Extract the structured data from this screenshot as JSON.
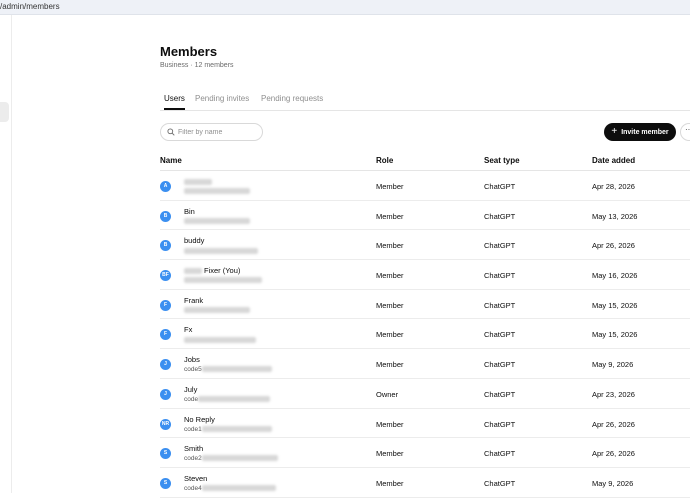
{
  "browser": {
    "url": "/admin/members"
  },
  "header": {
    "title": "Members",
    "subtitle": "Business · 12 members"
  },
  "tabs": [
    {
      "label": "Users",
      "active": true
    },
    {
      "label": "Pending invites",
      "active": false
    },
    {
      "label": "Pending requests",
      "active": false
    }
  ],
  "search": {
    "placeholder": "Filter by name"
  },
  "toolbar": {
    "invite_label": "Invite member",
    "more_label": "···"
  },
  "table": {
    "columns": [
      "Name",
      "Role",
      "Seat type",
      "Date added"
    ],
    "rows": [
      {
        "initials": "A",
        "name": "",
        "email": "",
        "role": "Member",
        "seat": "ChatGPT",
        "date": "Apr 28, 2026"
      },
      {
        "initials": "B",
        "name": "Bin",
        "email": "",
        "role": "Member",
        "seat": "ChatGPT",
        "date": "May 13, 2026"
      },
      {
        "initials": "B",
        "name": "buddy",
        "email": "",
        "role": "Member",
        "seat": "ChatGPT",
        "date": "Apr 26, 2026"
      },
      {
        "initials": "BF",
        "name": "Fixer (You)",
        "email": "",
        "role": "Member",
        "seat": "ChatGPT",
        "date": "May 16, 2026"
      },
      {
        "initials": "F",
        "name": "Frank",
        "email": "",
        "role": "Member",
        "seat": "ChatGPT",
        "date": "May 15, 2026"
      },
      {
        "initials": "F",
        "name": "Fx",
        "email": "",
        "role": "Member",
        "seat": "ChatGPT",
        "date": "May 15, 2026"
      },
      {
        "initials": "J",
        "name": "Jobs",
        "email": "code5",
        "role": "Member",
        "seat": "ChatGPT",
        "date": "May 9, 2026"
      },
      {
        "initials": "J",
        "name": "July",
        "email": "code",
        "role": "Owner",
        "seat": "ChatGPT",
        "date": "Apr 23, 2026"
      },
      {
        "initials": "NR",
        "name": "No Reply",
        "email": "code1",
        "role": "Member",
        "seat": "ChatGPT",
        "date": "Apr 26, 2026"
      },
      {
        "initials": "S",
        "name": "Smith",
        "email": "code2",
        "role": "Member",
        "seat": "ChatGPT",
        "date": "Apr 26, 2026"
      },
      {
        "initials": "S",
        "name": "Steven",
        "email": "code4",
        "role": "Member",
        "seat": "ChatGPT",
        "date": "May 9, 2026"
      }
    ]
  },
  "colors": {
    "avatar": "#3b8ff0",
    "primary_button": "#0d0d0d"
  }
}
